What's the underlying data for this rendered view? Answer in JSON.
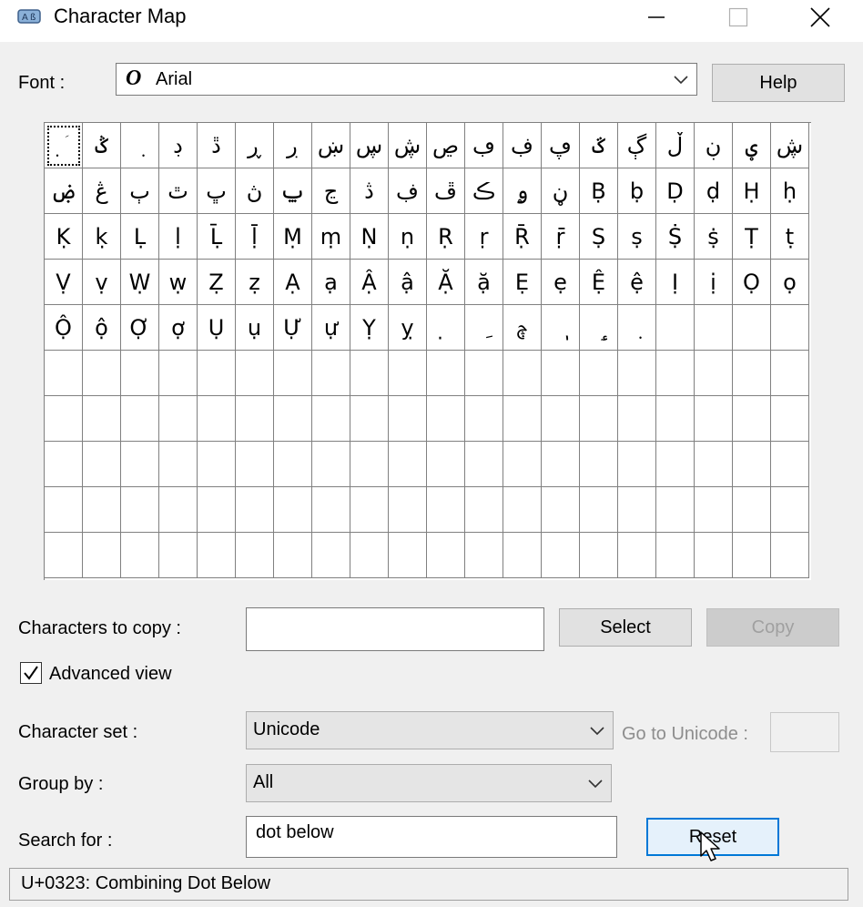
{
  "window": {
    "title": "Character Map",
    "controls": {
      "minimize": "minimize-icon",
      "maximize": "maximize-icon",
      "close": "close-icon"
    }
  },
  "font": {
    "label": "Font :",
    "value": "Arial",
    "type_glyph": "O",
    "help_label": "Help"
  },
  "grid": {
    "rows": [
      [
        "ؘ̣",
        "ݣ",
        "ٜ",
        "ڊ",
        "ڐ",
        "ڕ",
        "ڔ",
        "ښ",
        "ڛ",
        "ڜ",
        "ڝ",
        "ڢ",
        "ڣ",
        "ڥ",
        "ػ",
        "ڳ",
        "ڵ",
        "ڹ",
        "ؠ",
        "ڜ"
      ],
      [
        "ۻ",
        "ڠ",
        "ٻ",
        "ٿ",
        "ڀ",
        "ڽ",
        "ݐ",
        "ڃ",
        "ڎ",
        "ڣ",
        "ڦ",
        "ڪ",
        "ۄ",
        "ڼ",
        "Ḅ",
        "ḅ",
        "Ḍ",
        "ḍ",
        "Ḥ",
        "ḥ"
      ],
      [
        "Ḳ",
        "ḳ",
        "Ḷ",
        "ḷ",
        "Ḹ",
        "ḹ",
        "Ṃ",
        "ṃ",
        "Ṇ",
        "ṇ",
        "Ṛ",
        "ṛ",
        "Ṝ",
        "ṝ",
        "Ṣ",
        "ṣ",
        "Ṩ",
        "ṩ",
        "Ṭ",
        "ṭ"
      ],
      [
        "Ṿ",
        "ṿ",
        "Ẉ",
        "ẉ",
        "Ẓ",
        "ẓ",
        "Ạ",
        "ạ",
        "Ậ",
        "ậ",
        "Ặ",
        "ặ",
        "Ẹ",
        "ẹ",
        "Ệ",
        "ệ",
        "Ị",
        "ị",
        "Ọ",
        "ọ"
      ],
      [
        "Ộ",
        "ộ",
        "Ợ",
        "ợ",
        "Ụ",
        "ụ",
        "Ự",
        "ự",
        "Ỵ",
        "ỵ",
        "̣",
        "ِ",
        "ࣆ",
        "ٖ",
        "ٟ",
        "ٜ",
        "",
        "",
        "",
        ""
      ],
      [
        "",
        "",
        "",
        "",
        "",
        "",
        "",
        "",
        "",
        "",
        "",
        "",
        "",
        "",
        "",
        "",
        "",
        "",
        "",
        ""
      ],
      [
        "",
        "",
        "",
        "",
        "",
        "",
        "",
        "",
        "",
        "",
        "",
        "",
        "",
        "",
        "",
        "",
        "",
        "",
        "",
        ""
      ],
      [
        "",
        "",
        "",
        "",
        "",
        "",
        "",
        "",
        "",
        "",
        "",
        "",
        "",
        "",
        "",
        "",
        "",
        "",
        "",
        ""
      ],
      [
        "",
        "",
        "",
        "",
        "",
        "",
        "",
        "",
        "",
        "",
        "",
        "",
        "",
        "",
        "",
        "",
        "",
        "",
        "",
        ""
      ],
      [
        "",
        "",
        "",
        "",
        "",
        "",
        "",
        "",
        "",
        "",
        "",
        "",
        "",
        "",
        "",
        "",
        "",
        "",
        "",
        ""
      ]
    ]
  },
  "copy": {
    "label": "Characters to copy :",
    "value": "",
    "select_label": "Select",
    "copy_label": "Copy"
  },
  "advanced_view": {
    "label": "Advanced view",
    "checked": true
  },
  "character_set": {
    "label": "Character set :",
    "value": "Unicode"
  },
  "goto_unicode": {
    "label": "Go to Unicode :",
    "value": ""
  },
  "group_by": {
    "label": "Group by :",
    "value": "All"
  },
  "search": {
    "label": "Search for :",
    "value": "dot below",
    "reset_label": "Reset"
  },
  "status": {
    "text": "U+0323: Combining Dot Below"
  }
}
